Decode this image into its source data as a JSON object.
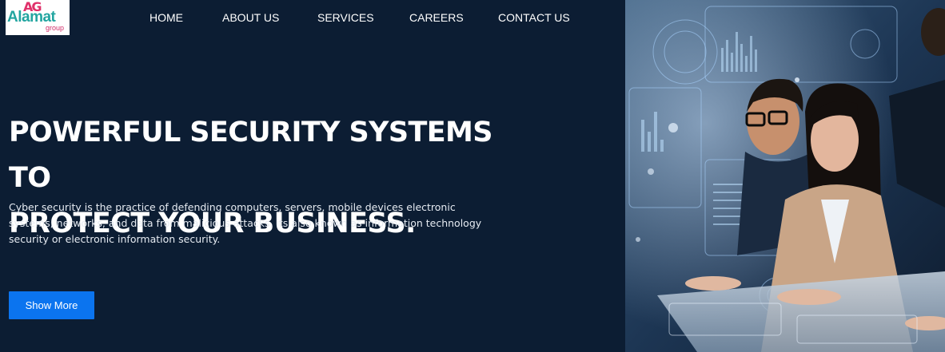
{
  "brand": {
    "logo_mark": "AG",
    "logo_name": "Alamat",
    "logo_sub": "group"
  },
  "nav": {
    "items": [
      {
        "label": "HOME"
      },
      {
        "label": "ABOUT US"
      },
      {
        "label": "SERVICES"
      },
      {
        "label": "CAREERS"
      },
      {
        "label": "CONTACT US"
      }
    ]
  },
  "hero": {
    "title_line1": "POWERFUL SECURITY SYSTEMS TO",
    "title_line2": "PROTECT YOUR BUSINESS.",
    "description": "Cyber security is the practice of defending computers, servers, mobile devices electronic systems, networks, and data from malicious attacks, its also known as information technology security or electronic information security.",
    "button_label": "Show More"
  },
  "image": {
    "subject": "security-team-hologram-photo"
  }
}
